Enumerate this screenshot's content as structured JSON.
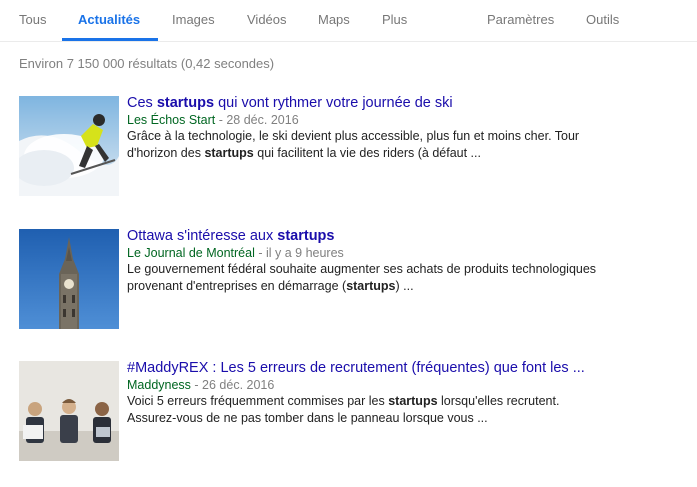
{
  "tabs": {
    "all": "Tous",
    "news": "Actualités",
    "images": "Images",
    "videos": "Vidéos",
    "maps": "Maps",
    "more": "Plus",
    "settings": "Paramètres",
    "tools": "Outils"
  },
  "stats": "Environ 7 150 000 résultats (0,42 secondes)",
  "results": [
    {
      "title_pre": "Ces ",
      "title_bold": "startups",
      "title_post": " qui vont rythmer votre journée de ski",
      "source": "Les Échos Start",
      "date": " - 28 déc. 2016",
      "snippet1": "Grâce à la technologie, le ski devient plus accessible, plus fun et moins cher. Tour",
      "snippet2_pre": "d'horizon des ",
      "snippet2_bold": "startups",
      "snippet2_post": " qui facilitent la vie des riders (à défaut ...",
      "thumb_icon": "skier-image"
    },
    {
      "title_pre": "Ottawa s'intéresse aux ",
      "title_bold": "startups",
      "title_post": "",
      "source": "Le Journal de Montréal",
      "date": " - il y a 9 heures",
      "snippet1": "Le gouvernement fédéral souhaite augmenter ses achats de produits technologiques",
      "snippet2_pre": "provenant d'entreprises en démarrage (",
      "snippet2_bold": "startups",
      "snippet2_post": ") ...",
      "thumb_icon": "parliament-tower-image"
    },
    {
      "title_pre": "#MaddyREX : Les 5 erreurs de recrutement (fréquentes) que font les ...",
      "title_bold": "",
      "title_post": "",
      "source": "Maddyness",
      "date": " - 26 déc. 2016",
      "snippet1_pre": "Voici 5 erreurs fréquemment commises par les ",
      "snippet1_bold": "startups",
      "snippet1_post": " lorsqu'elles recrutent.",
      "snippet2_pre": "Assurez-vous de ne pas tomber dans le panneau lorsque vous ...",
      "snippet2_bold": "",
      "snippet2_post": "",
      "thumb_icon": "job-candidates-image"
    }
  ],
  "colors": {
    "accent": "#1a73e8",
    "link": "#1a0dab",
    "source": "#006621",
    "muted": "#808080"
  }
}
